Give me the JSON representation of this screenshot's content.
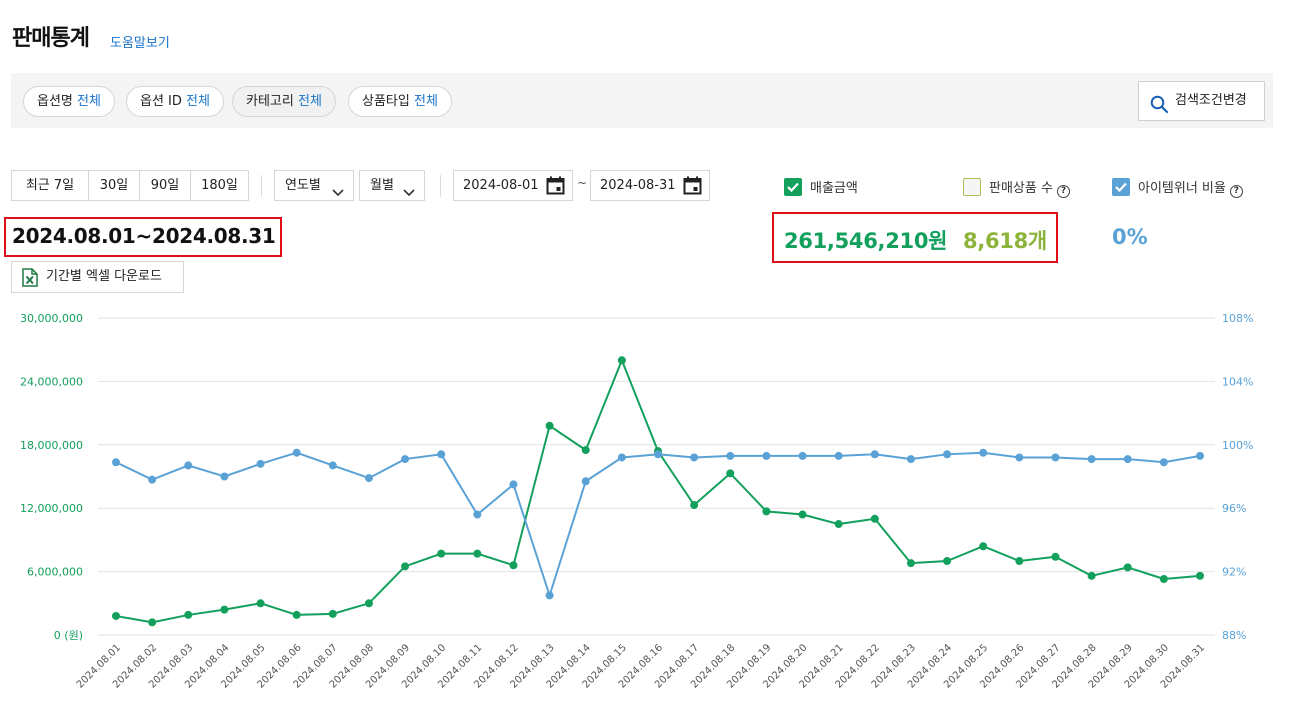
{
  "header": {
    "title": "판매통계",
    "help_link": "도움말보기"
  },
  "filters": [
    {
      "label": "옵션명",
      "value": "전체"
    },
    {
      "label": "옵션 ID",
      "value": "전체"
    },
    {
      "label": "카테고리",
      "value": "전체"
    },
    {
      "label": "상품타입",
      "value": "전체"
    }
  ],
  "search_button": "검색조건변경",
  "period_buttons": [
    "최근 7일",
    "30일",
    "90일",
    "180일"
  ],
  "dropdowns": {
    "yearly": "연도별",
    "monthly": "월별"
  },
  "date_range": {
    "start": "2024-08-01",
    "sep": "~",
    "end": "2024-08-31"
  },
  "legend": {
    "sales": {
      "label": "매출금액",
      "checked": true,
      "color": "#13a05c"
    },
    "items": {
      "label": "판매상품 수",
      "checked": false,
      "color": "#a8c24f"
    },
    "ratio": {
      "label": "아이템위너 비율",
      "checked": true,
      "color": "#5aa2d6"
    }
  },
  "summary": {
    "range": "2024.08.01~2024.08.31",
    "sales": "261,546,210원",
    "items": "8,618개",
    "ratio": "0%"
  },
  "excel_button": "기간별 엑셀 다운로드",
  "chart_data": {
    "type": "line",
    "x": [
      "2024.08.01",
      "2024.08.02",
      "2024.08.03",
      "2024.08.04",
      "2024.08.05",
      "2024.08.06",
      "2024.08.07",
      "2024.08.08",
      "2024.08.09",
      "2024.08.10",
      "2024.08.11",
      "2024.08.12",
      "2024.08.13",
      "2024.08.14",
      "2024.08.15",
      "2024.08.16",
      "2024.08.17",
      "2024.08.18",
      "2024.08.19",
      "2024.08.20",
      "2024.08.21",
      "2024.08.22",
      "2024.08.23",
      "2024.08.24",
      "2024.08.25",
      "2024.08.26",
      "2024.08.27",
      "2024.08.28",
      "2024.08.29",
      "2024.08.30",
      "2024.08.31"
    ],
    "left_axis": {
      "ticks": [
        "0 (원)",
        "6,000,000",
        "12,000,000",
        "18,000,000",
        "24,000,000",
        "30,000,000"
      ],
      "ylim": [
        0,
        30000000
      ],
      "color": "#13a05c"
    },
    "right_axis": {
      "ticks": [
        "88%",
        "92%",
        "96%",
        "100%",
        "104%",
        "108%"
      ],
      "ylim": [
        88,
        108
      ],
      "color": "#5aa2d6"
    },
    "grid": true,
    "series": [
      {
        "axis": "left",
        "color": "#13a05c",
        "values": [
          1800000,
          1200000,
          1900000,
          2400000,
          3000000,
          1900000,
          2000000,
          3000000,
          6500000,
          7700000,
          7700000,
          6600000,
          19800000,
          17500000,
          26000000,
          17400000,
          12300000,
          15300000,
          11700000,
          11400000,
          10500000,
          11000000,
          6800000,
          7000000,
          8400000,
          7000000,
          7400000,
          5600000,
          6400000,
          5300000,
          5600000
        ]
      },
      {
        "axis": "right",
        "color": "#5aa2d6",
        "values": [
          98.9,
          97.8,
          98.7,
          98.0,
          98.8,
          99.5,
          98.7,
          97.9,
          99.1,
          99.4,
          95.6,
          97.5,
          90.5,
          97.7,
          99.2,
          99.4,
          99.2,
          99.3,
          99.3,
          99.3,
          99.3,
          99.4,
          99.1,
          99.4,
          99.5,
          99.2,
          99.2,
          99.1,
          99.1,
          98.9,
          99.3
        ]
      }
    ]
  }
}
